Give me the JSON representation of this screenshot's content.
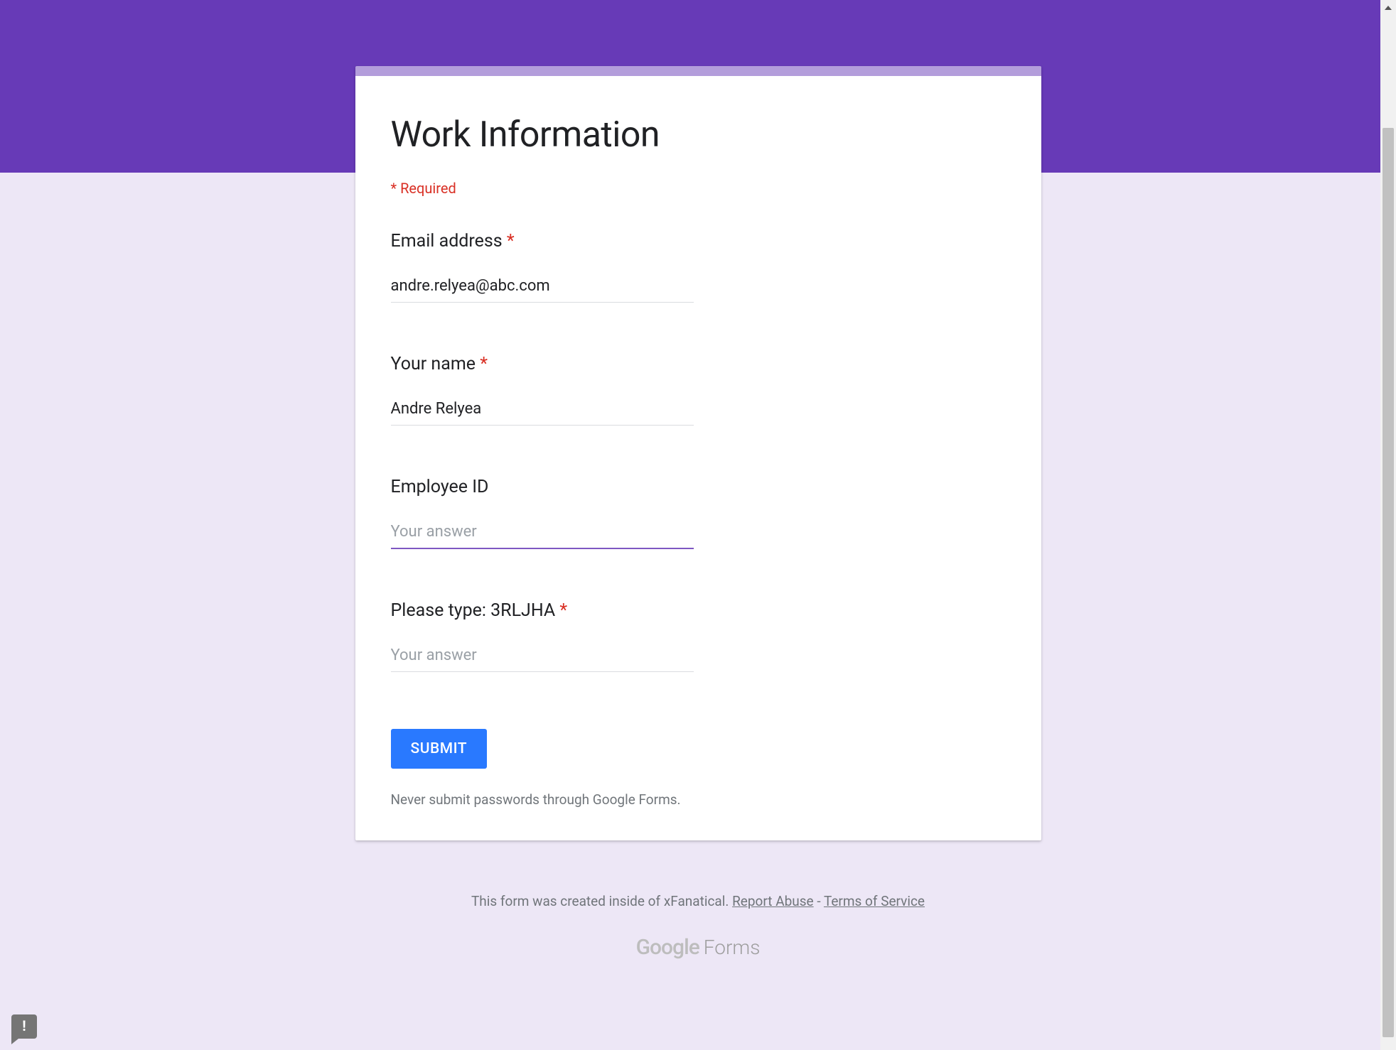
{
  "form": {
    "title": "Work Information",
    "required_note": "* Required",
    "questions": [
      {
        "label": "Email address",
        "required": true,
        "value": "andre.relyea@abc.com",
        "placeholder": ""
      },
      {
        "label": "Your name",
        "required": true,
        "value": "Andre Relyea",
        "placeholder": ""
      },
      {
        "label": "Employee ID",
        "required": false,
        "value": "",
        "placeholder": "Your answer"
      },
      {
        "label": "Please type: 3RLJHA",
        "required": true,
        "value": "",
        "placeholder": "Your answer"
      }
    ],
    "submit_label": "SUBMIT",
    "password_note": "Never submit passwords through Google Forms."
  },
  "footer": {
    "created_text": "This form was created inside of xFanatical. ",
    "report_abuse": "Report Abuse",
    "separator": " - ",
    "terms": "Terms of Service",
    "logo_google": "Google",
    "logo_forms": "Forms"
  }
}
